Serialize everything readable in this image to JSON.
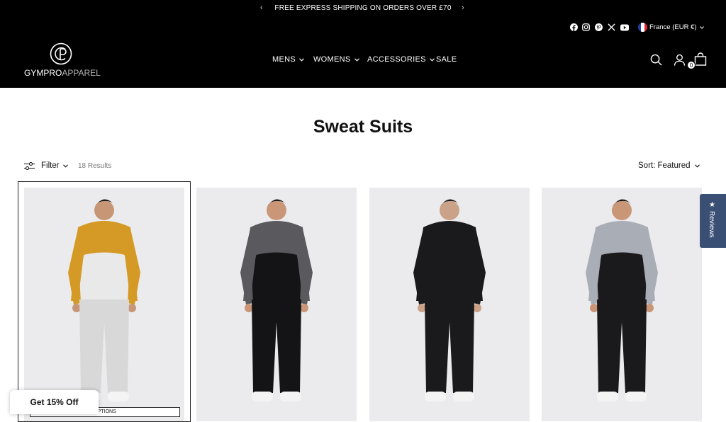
{
  "announcement": {
    "text": "FREE EXPRESS SHIPPING ON ORDERS OVER £70",
    "prev": "‹",
    "next": "›"
  },
  "social": [
    "facebook-icon",
    "instagram-icon",
    "pinterest-icon",
    "x-icon",
    "youtube-icon"
  ],
  "locale": {
    "label": "France (EUR €)"
  },
  "brand": {
    "bold": "GYMPRO",
    "light": "APPAREL"
  },
  "nav": [
    {
      "label": "MENS"
    },
    {
      "label": "WOMENS"
    },
    {
      "label": "ACCESSORIES"
    },
    {
      "label": "SALE"
    }
  ],
  "cart": {
    "count": "0"
  },
  "page": {
    "title": "Sweat Suits"
  },
  "toolbar": {
    "filter_label": "Filter",
    "results": "18 Results",
    "sort_label": "Sort: Featured"
  },
  "products": [
    {
      "jacket": "#d49a25",
      "body": "#e9e9e9",
      "pants": "#d8d8d8",
      "skin": "#c79676"
    },
    {
      "jacket": "#5a5a5e",
      "body": "#141416",
      "pants": "#141416",
      "skin": "#c99677"
    },
    {
      "jacket": "#1a1a1c",
      "body": "#1a1a1c",
      "pants": "#1a1a1c",
      "skin": "#caa287"
    },
    {
      "jacket": "#a9adb6",
      "body": "#1a1a1c",
      "pants": "#1a1a1c",
      "skin": "#c99677"
    }
  ],
  "reviews_tab": {
    "label": "Reviews",
    "star": "★"
  },
  "discount": {
    "label": "Get 15% Off"
  },
  "quick_view": {
    "label": "OPTIONS"
  },
  "colors": {
    "header_bg": "#000000",
    "reviews_bg": "#3a4f74"
  }
}
